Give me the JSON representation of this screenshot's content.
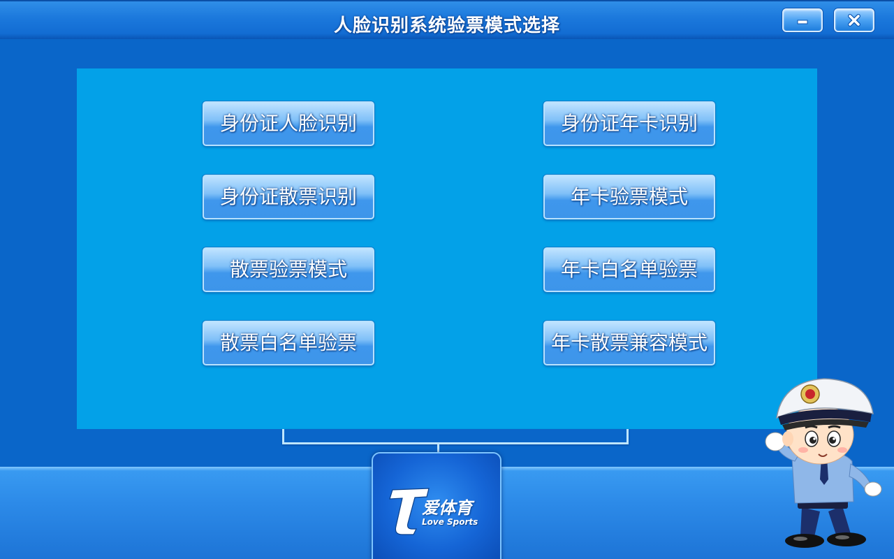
{
  "window": {
    "title": "人脸识别系统验票模式选择",
    "minimize_icon": "minimize-icon",
    "close_icon": "close-icon"
  },
  "modes": [
    {
      "id": "id-card-face",
      "label": "身份证人脸识别"
    },
    {
      "id": "id-card-annual",
      "label": "身份证年卡识别"
    },
    {
      "id": "id-card-single",
      "label": "身份证散票识别"
    },
    {
      "id": "annual-check",
      "label": "年卡验票模式"
    },
    {
      "id": "single-check",
      "label": "散票验票模式"
    },
    {
      "id": "annual-whitelist",
      "label": "年卡白名单验票"
    },
    {
      "id": "single-whitelist",
      "label": "散票白名单验票"
    },
    {
      "id": "annual-single-compat",
      "label": "年卡散票兼容模式"
    }
  ],
  "logo": {
    "cn_text": "爱体育",
    "en_text": "Love Sports",
    "mark": "T"
  },
  "colors": {
    "background": "#0a66c9",
    "panel": "#03a1e8",
    "button_top": "#bfe3ff",
    "button_bottom": "#3d95ea",
    "text": "#ffffff"
  }
}
